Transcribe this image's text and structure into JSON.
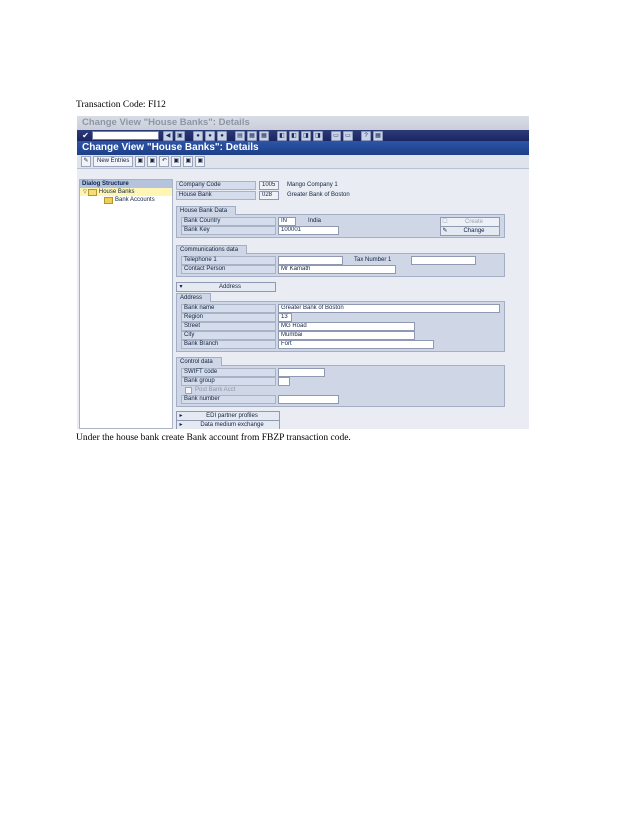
{
  "doc": {
    "caption_top": "Transaction Code: FI12",
    "caption_bottom": "Under the house bank create Bank account from FBZP transaction code."
  },
  "window": {
    "faded_title": "Change View \"House Banks\": Details",
    "title": "Change View \"House Banks\": Details"
  },
  "app_toolbar": {
    "new_entries_label": "New Entries"
  },
  "tree": {
    "header": "Dialog Structure",
    "items": [
      {
        "label": "House Banks"
      },
      {
        "label": "Bank Accounts"
      }
    ]
  },
  "header_fields": {
    "company_code_label": "Company Code",
    "company_code_value": "1005",
    "company_name": "Mango Company 1",
    "house_bank_label": "House Bank",
    "house_bank_value": "028",
    "house_bank_name": "Greater Bank of Boston"
  },
  "house_bank_data": {
    "title": "House Bank Data",
    "bank_country_label": "Bank Country",
    "bank_country_value": "IN",
    "country_name": "India",
    "bank_key_label": "Bank Key",
    "bank_key_value": "100001",
    "create_label": "Create",
    "change_label": "Change"
  },
  "communications": {
    "title": "Communications data",
    "telephone_label": "Telephone 1",
    "telephone_value": "",
    "tax_number_label": "Tax Number 1",
    "tax_number_value": "",
    "contact_label": "Contact Person",
    "contact_value": "Mr Kamath"
  },
  "address_button": {
    "label": "Address"
  },
  "address": {
    "title": "Address",
    "bank_name_label": "Bank name",
    "bank_name_value": "Greater Bank of Boston",
    "region_label": "Region",
    "region_value": "13",
    "street_label": "Street",
    "street_value": "MG Road",
    "city_label": "City",
    "city_value": "Mumbai",
    "branch_label": "Bank Branch",
    "branch_value": "Fort"
  },
  "control": {
    "title": "Control data",
    "swift_label": "SWIFT code",
    "swift_value": "",
    "bank_group_label": "Bank group",
    "bank_group_value": "",
    "post_bank_label": "Post Bank Acct",
    "bank_number_label": "Bank number",
    "bank_number_value": ""
  },
  "bottom_buttons": {
    "edi_label": "EDI partner profiles",
    "dme_label": "Data medium exchange"
  }
}
